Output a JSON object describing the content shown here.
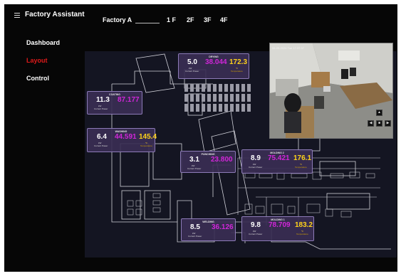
{
  "app": {
    "title": "Factory Assistant",
    "menu_icon": "hamburger-menu-icon"
  },
  "nav": [
    {
      "label": "Dashboard",
      "active": false
    },
    {
      "label": "Layout",
      "active": true
    },
    {
      "label": "Control",
      "active": false
    }
  ],
  "header": {
    "factory": "Factory A",
    "floors": [
      "1 F",
      "2F",
      "3F",
      "4F"
    ]
  },
  "colors": {
    "background": "#060606",
    "active_nav": "#e01a1a",
    "power": "#ffffff",
    "mid_value": "#d026d8",
    "temperature": "#ffd21a",
    "card_bg": "#3a2e54",
    "card_border": "#8d7bb8",
    "floorplan_bg": "#141522"
  },
  "cards": {
    "drying": {
      "title": "DRYING",
      "power": "5.0",
      "power_unit": "kW",
      "power_label": "Current Power",
      "mid": "38.044",
      "mid_unit": "",
      "temp": "172.3",
      "temp_unit": "°F",
      "temp_label": "Temperature"
    },
    "coating": {
      "title": "COATING",
      "power": "11.3",
      "power_unit": "kW",
      "power_label": "Current Power",
      "mid": "87.177",
      "mid_unit": ""
    },
    "washing": {
      "title": "WASHING",
      "power": "6.4",
      "power_unit": "kW",
      "power_label": "Current Power",
      "mid": "44.591",
      "mid_unit": "",
      "temp": "145.4",
      "temp_unit": "°F",
      "temp_label": "Temperature"
    },
    "punching": {
      "title": "PUNCHING",
      "power": "3.1",
      "power_unit": "kW",
      "power_label": "Current Power",
      "mid": "23.800",
      "mid_unit": ""
    },
    "molding2": {
      "title": "MOLDING 2",
      "power": "8.9",
      "power_unit": "kW",
      "power_label": "Current Power",
      "mid": "75.421",
      "mid_unit": "",
      "temp": "176.1",
      "temp_unit": "°F",
      "temp_label": "Temperature"
    },
    "welding": {
      "title": "WELDING",
      "power": "8.5",
      "power_unit": "kW",
      "power_label": "Current Power",
      "mid": "36.126",
      "mid_unit": ""
    },
    "molding1": {
      "title": "MOLDING 1",
      "power": "9.8",
      "power_unit": "kW",
      "power_label": "Current Power",
      "mid": "78.709",
      "mid_unit": "",
      "temp": "183.2",
      "temp_unit": "°F",
      "temp_label": "Temperature"
    }
  },
  "camera": {
    "timestamp": "06-05-2024 Tue 17:37:37",
    "controls": {
      "up": "▲",
      "left": "◀",
      "home": "■",
      "right": "▶"
    }
  }
}
